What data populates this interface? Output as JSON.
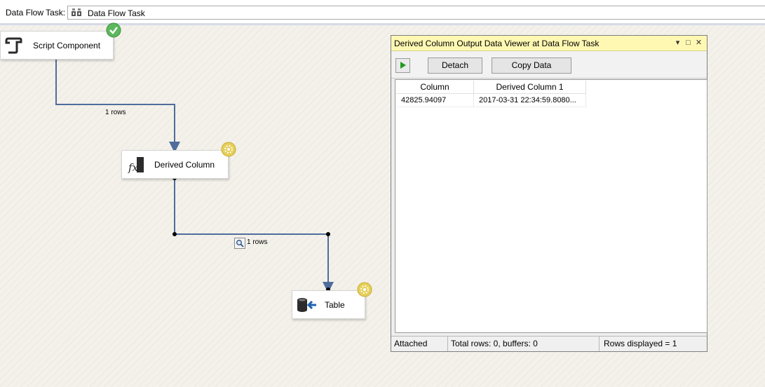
{
  "topbar": {
    "label": "Data Flow Task:",
    "task_value": "Data Flow Task",
    "task_icon": "data-flow-task-icon"
  },
  "components": {
    "script": {
      "label": "Script Component",
      "icon": "script-component-icon",
      "status": "success"
    },
    "derived": {
      "label": "Derived Column",
      "icon": "derived-column-icon",
      "status": "running"
    },
    "table": {
      "label": "Table",
      "icon": "destination-table-icon",
      "status": "running"
    }
  },
  "paths": {
    "script_to_derived": {
      "rows_label": "1 rows"
    },
    "derived_to_table": {
      "rows_label": "1 rows",
      "has_data_viewer": true
    }
  },
  "viewer": {
    "title": "Derived Column Output Data Viewer at Data Flow Task",
    "buttons": {
      "detach": "Detach",
      "copy": "Copy Data"
    },
    "columns": [
      "Column",
      "Derived Column 1"
    ],
    "rows": [
      [
        "42825.94097",
        "2017-03-31 22:34:59.8080..."
      ]
    ],
    "status": {
      "attached": "Attached",
      "totals": "Total rows: 0, buffers: 0",
      "displayed": "Rows displayed = 1"
    }
  },
  "colors": {
    "flow_line": "#4f6d9c",
    "success_badge": "#5cb85c",
    "running_badge": "#e6cf5a",
    "viewer_title_bg": "#fff8b3"
  }
}
